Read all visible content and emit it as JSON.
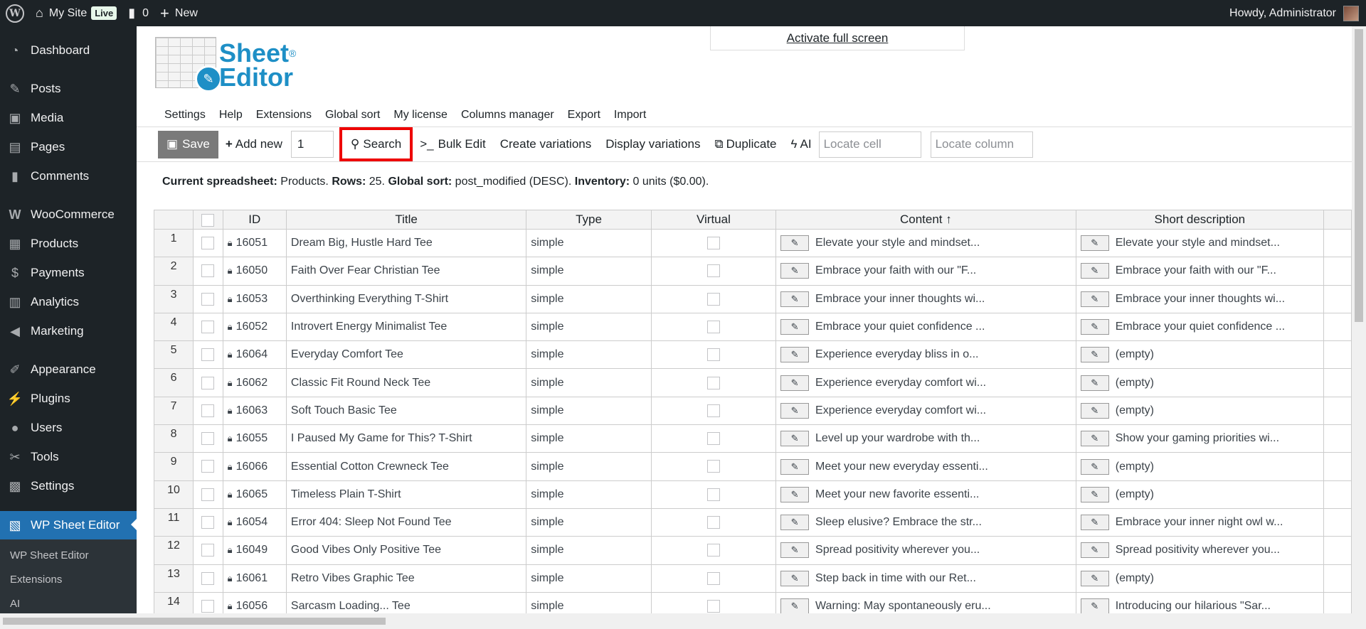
{
  "adminbar": {
    "site_name": "My Site",
    "live_badge": "Live",
    "comments_count": "0",
    "new_label": "New",
    "greeting": "Howdy, Administrator"
  },
  "sidebar": {
    "items": [
      {
        "label": "Dashboard",
        "icon": "dashboard-icon"
      },
      {
        "label": "Posts",
        "icon": "pin-icon"
      },
      {
        "label": "Media",
        "icon": "media-icon"
      },
      {
        "label": "Pages",
        "icon": "pages-icon"
      },
      {
        "label": "Comments",
        "icon": "comment-icon"
      },
      {
        "label": "WooCommerce",
        "icon": "woo-icon"
      },
      {
        "label": "Products",
        "icon": "archive-icon"
      },
      {
        "label": "Payments",
        "icon": "dollar-icon"
      },
      {
        "label": "Analytics",
        "icon": "bar-chart-icon"
      },
      {
        "label": "Marketing",
        "icon": "megaphone-icon"
      },
      {
        "label": "Appearance",
        "icon": "brush-icon"
      },
      {
        "label": "Plugins",
        "icon": "plug-icon"
      },
      {
        "label": "Users",
        "icon": "user-icon"
      },
      {
        "label": "Tools",
        "icon": "wrench-icon"
      },
      {
        "label": "Settings",
        "icon": "settings-icon"
      },
      {
        "label": "WP Sheet Editor",
        "icon": "spreadsheet-icon"
      }
    ],
    "submenu": [
      "WP Sheet Editor",
      "Extensions",
      "AI"
    ]
  },
  "logo": {
    "line1": "Sheet",
    "line2": "Editor",
    "reg": "®"
  },
  "fullscreen_link": "Activate full screen",
  "topmenu": [
    "Settings",
    "Help",
    "Extensions",
    "Global sort",
    "My license",
    "Columns manager",
    "Export",
    "Import"
  ],
  "toolbar": {
    "save": "Save",
    "add_new": "Add new",
    "add_qty": "1",
    "search": "Search",
    "bulk_edit": "Bulk Edit",
    "create_variations": "Create variations",
    "display_variations": "Display variations",
    "duplicate": "Duplicate",
    "ai": "AI",
    "locate_cell_placeholder": "Locate cell",
    "locate_column_placeholder": "Locate column"
  },
  "info": {
    "l1": "Current spreadsheet:",
    "v1": " Products. ",
    "l2": "Rows:",
    "v2": " 25. ",
    "l3": "Global sort:",
    "v3": " post_modified (DESC). ",
    "l4": "Inventory:",
    "v4": " 0 units ($0.00)."
  },
  "table": {
    "headers": {
      "id": "ID",
      "title": "Title",
      "type": "Type",
      "virtual": "Virtual",
      "content": "Content",
      "short": "Short description"
    },
    "rows": [
      {
        "n": "1",
        "id": "16051",
        "title": "Dream Big, Hustle Hard Tee",
        "type": "simple",
        "content": "Elevate your style and mindset...",
        "short": "Elevate your style and mindset..."
      },
      {
        "n": "2",
        "id": "16050",
        "title": "Faith Over Fear Christian Tee",
        "type": "simple",
        "content": "Embrace your faith with our \"F...",
        "short": "Embrace your faith with our \"F..."
      },
      {
        "n": "3",
        "id": "16053",
        "title": "Overthinking Everything T-Shirt",
        "type": "simple",
        "content": "Embrace your inner thoughts wi...",
        "short": "Embrace your inner thoughts wi..."
      },
      {
        "n": "4",
        "id": "16052",
        "title": "Introvert Energy Minimalist Tee",
        "type": "simple",
        "content": "Embrace your quiet confidence ...",
        "short": "Embrace your quiet confidence ..."
      },
      {
        "n": "5",
        "id": "16064",
        "title": "Everyday Comfort Tee",
        "type": "simple",
        "content": "Experience everyday bliss in o...",
        "short": "(empty)"
      },
      {
        "n": "6",
        "id": "16062",
        "title": "Classic Fit Round Neck Tee",
        "type": "simple",
        "content": "Experience everyday comfort wi...",
        "short": "(empty)"
      },
      {
        "n": "7",
        "id": "16063",
        "title": "Soft Touch Basic Tee",
        "type": "simple",
        "content": "Experience everyday comfort wi...",
        "short": "(empty)"
      },
      {
        "n": "8",
        "id": "16055",
        "title": "I Paused My Game for This? T-Shirt",
        "type": "simple",
        "content": "Level up your wardrobe with th...",
        "short": "Show your gaming priorities wi..."
      },
      {
        "n": "9",
        "id": "16066",
        "title": "Essential Cotton Crewneck Tee",
        "type": "simple",
        "content": "Meet your new everyday essenti...",
        "short": "(empty)"
      },
      {
        "n": "10",
        "id": "16065",
        "title": "Timeless Plain T-Shirt",
        "type": "simple",
        "content": "Meet your new favorite essenti...",
        "short": "(empty)"
      },
      {
        "n": "11",
        "id": "16054",
        "title": "Error 404: Sleep Not Found Tee",
        "type": "simple",
        "content": "Sleep elusive? Embrace the str...",
        "short": "Embrace your inner night owl w..."
      },
      {
        "n": "12",
        "id": "16049",
        "title": "Good Vibes Only Positive Tee",
        "type": "simple",
        "content": "Spread positivity wherever you...",
        "short": "Spread positivity wherever you..."
      },
      {
        "n": "13",
        "id": "16061",
        "title": "Retro Vibes Graphic Tee",
        "type": "simple",
        "content": "Step back in time with our Ret...",
        "short": "(empty)"
      },
      {
        "n": "14",
        "id": "16056",
        "title": "Sarcasm Loading... Tee",
        "type": "simple",
        "content": "Warning: May spontaneously eru...",
        "short": "Introducing our hilarious \"Sar..."
      }
    ]
  }
}
